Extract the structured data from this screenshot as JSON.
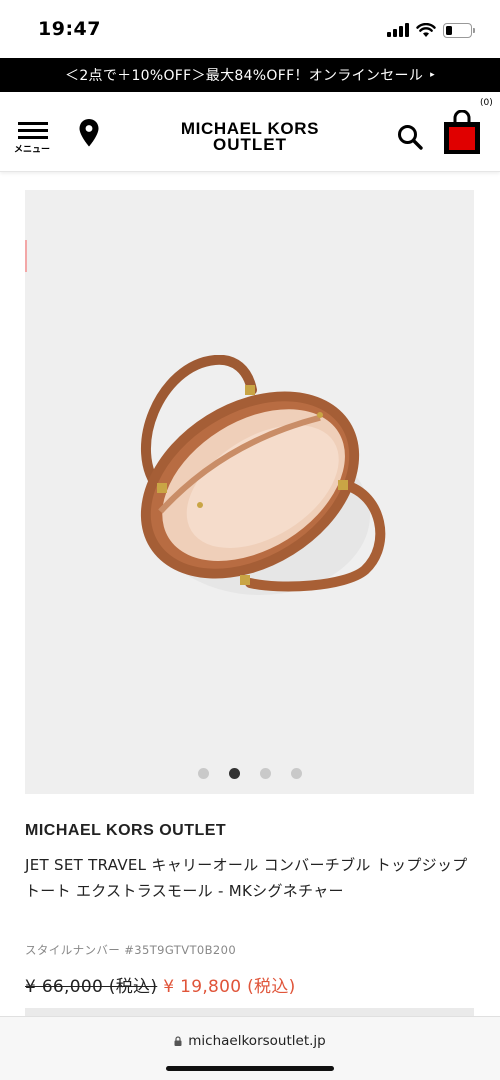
{
  "status_bar": {
    "time": "19:47",
    "icons": [
      "signal-icon",
      "wifi-icon",
      "battery-icon"
    ],
    "battery_level": 0.25
  },
  "promo": {
    "text": "＜2点で＋10%OFF＞最大84%OFF！オンラインセール",
    "arrow": "▸"
  },
  "header": {
    "menu_label": "メニュー",
    "logo_line1": "MICHAEL KORS",
    "logo_line2": "OUTLET",
    "cart_count": "(0)",
    "icons": [
      "menu-icon",
      "location-pin-icon",
      "search-icon",
      "shopping-bag-icon"
    ],
    "cart_color": "#e00000"
  },
  "gallery": {
    "image_alt": "tote bag top view",
    "dot_count": 4,
    "active_dot": 1
  },
  "product": {
    "brand": "MICHAEL KORS OUTLET",
    "title": "JET SET TRAVEL キャリーオール コンバーチブル トップジップ トート エクストラスモール - MKシグネチャー",
    "style_number": "スタイルナンバー #35T9GTVT0B200",
    "price_original": "¥ 66,000 (税込)",
    "price_sale": "¥ 19,800 (税込)",
    "sale_color": "#e0553a"
  },
  "browser": {
    "url": "michaelkorsoutlet.jp",
    "icons": [
      "lock-icon"
    ]
  }
}
